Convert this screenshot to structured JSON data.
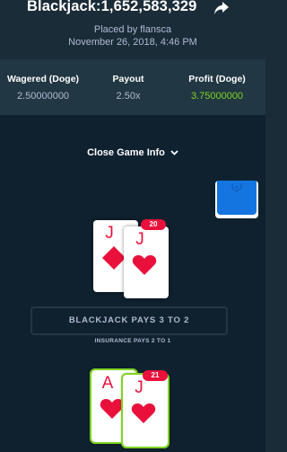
{
  "header": {
    "title": "Blackjack:1,652,583,329",
    "placed_by": "Placed by flansca",
    "date": "November 26, 2018, 4:46 PM"
  },
  "stats": {
    "wagered_label": "Wagered (Doge)",
    "wagered_value": "2.50000000",
    "payout_label": "Payout",
    "payout_value": "2.50x",
    "profit_label": "Profit (Doge)",
    "profit_value": "3.75000000",
    "profit_color": "#7ed321"
  },
  "game": {
    "close_info_label": "Close Game Info",
    "pays_label": "BLACKJACK PAYS 3 TO 2",
    "insurance_label": "INSURANCE PAYS 2 TO 1",
    "dealer": {
      "score": "20",
      "cards": [
        {
          "rank": "J",
          "suit": "diamond-icon"
        },
        {
          "rank": "J",
          "suit": "heart-icon"
        }
      ]
    },
    "player": {
      "score": "21",
      "cards": [
        {
          "rank": "A",
          "suit": "heart-icon"
        },
        {
          "rank": "J",
          "suit": "heart-icon"
        }
      ]
    }
  },
  "icons": {
    "share": "share-arrow-icon",
    "chevron": "chevron-down-icon",
    "deck": "card-deck-icon"
  },
  "colors": {
    "red_suit": "#e9113c",
    "win_outline": "#7ed321",
    "deck_back": "#1475e1"
  }
}
